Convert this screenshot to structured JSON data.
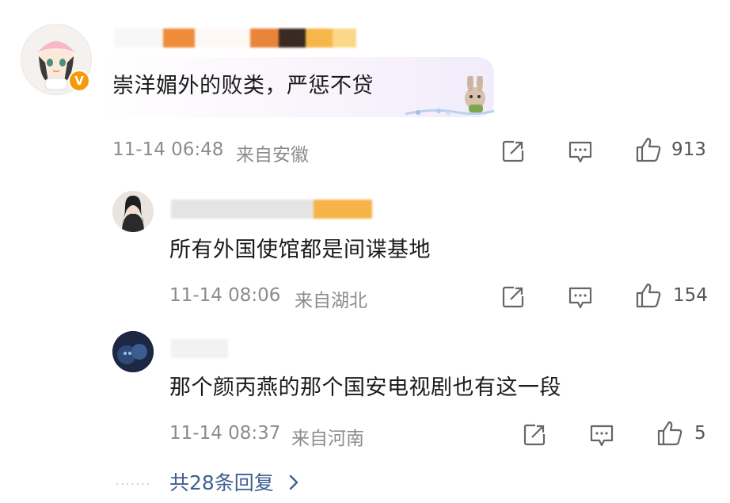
{
  "main_comment": {
    "text": "崇洋媚外的败类，严惩不贷",
    "time": "11-14 06:48",
    "location": "来自安徽",
    "likes": "913",
    "verified_badge_icon": "verified-v-icon"
  },
  "replies": [
    {
      "text": "所有外国使馆都是间谍基地",
      "time": "11-14 08:06",
      "location": "来自湖北",
      "likes": "154"
    },
    {
      "text": "那个颜丙燕的那个国安电视剧也有这一段",
      "time": "11-14 08:37",
      "location": "来自河南",
      "likes": "5"
    }
  ],
  "footer": {
    "reply_count_label": "共28条回复",
    "chevron": "›"
  },
  "icons": [
    "share-icon",
    "comment-icon",
    "like-icon",
    "chevron-right-icon"
  ],
  "colors": {
    "accent_link": "#3f5f92",
    "meta_gray": "#8c8c8c",
    "verified_orange": "#f59a0b"
  }
}
